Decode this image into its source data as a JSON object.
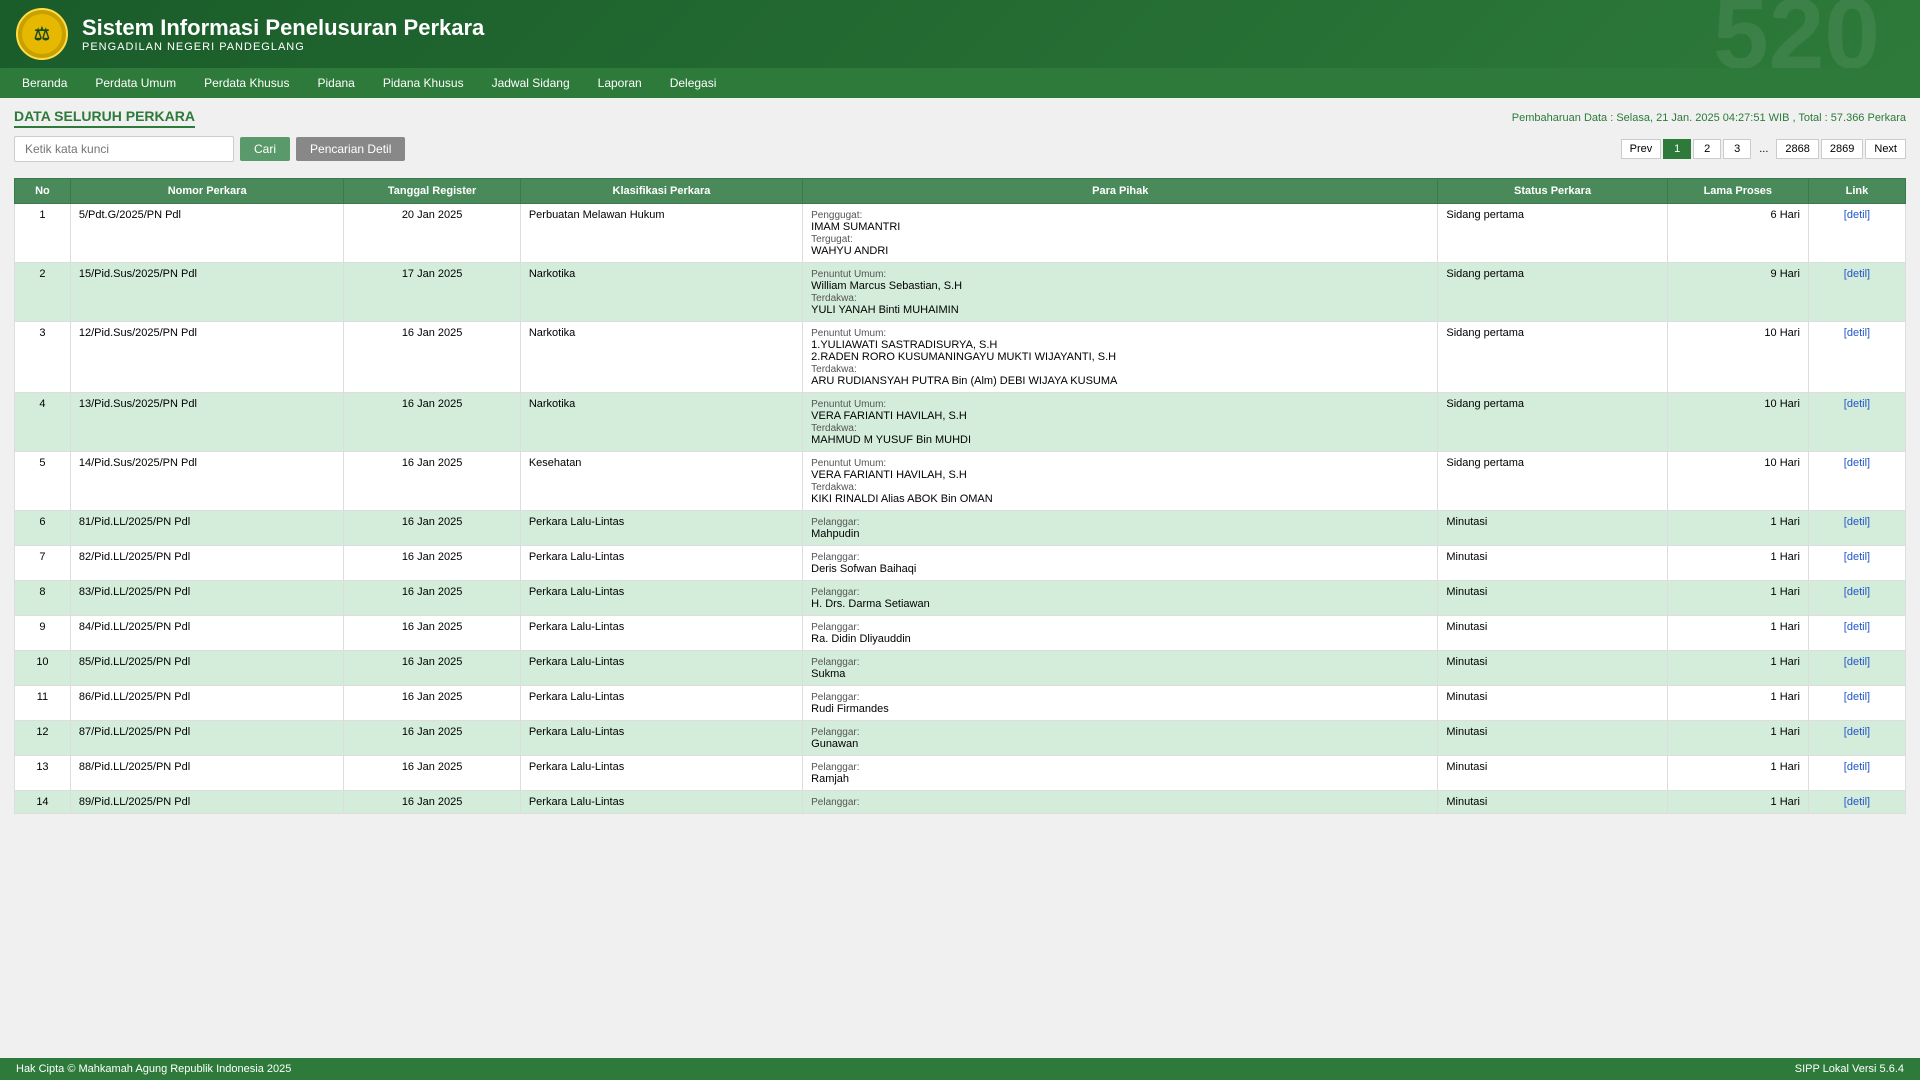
{
  "header": {
    "title": "Sistem Informasi Penelusuran Perkara",
    "subtitle": "PENGADILAN NEGERI PANDEGLANG",
    "watermark": "520"
  },
  "navbar": {
    "items": [
      "Beranda",
      "Perdata Umum",
      "Perdata Khusus",
      "Pidana",
      "Pidana Khusus",
      "Jadwal Sidang",
      "Laporan",
      "Delegasi"
    ]
  },
  "page": {
    "title": "DATA SELURUH PERKARA",
    "update_info": "Pembaharuan Data : Selasa, 21 Jan. 2025 04:27:51 WIB , Total : 57.366 Perkara"
  },
  "search": {
    "placeholder": "Ketik kata kunci",
    "search_label": "Cari",
    "detail_label": "Pencarian Detil"
  },
  "pagination": {
    "prev": "Prev",
    "next": "Next",
    "pages": [
      "1",
      "2",
      "3"
    ],
    "dots": "...",
    "last_pages": [
      "2868",
      "2869"
    ]
  },
  "table": {
    "headers": [
      "No",
      "Nomor Perkara",
      "Tanggal Register",
      "Klasifikasi Perkara",
      "Para Pihak",
      "Status Perkara",
      "Lama Proses",
      "Link"
    ],
    "rows": [
      {
        "no": "1",
        "nomor": "5/Pdt.G/2025/PN Pdl",
        "tanggal": "20 Jan 2025",
        "klasifikasi": "Perbuatan Melawan Hukum",
        "pihak": [
          {
            "label": "Penggugat:",
            "name": "IMAM SUMANTRI"
          },
          {
            "label": "Tergugat:",
            "name": "WAHYU ANDRI"
          }
        ],
        "status": "Sidang pertama",
        "lama": "6 Hari",
        "link": "[detil]"
      },
      {
        "no": "2",
        "nomor": "15/Pid.Sus/2025/PN Pdl",
        "tanggal": "17 Jan 2025",
        "klasifikasi": "Narkotika",
        "pihak": [
          {
            "label": "Penuntut Umum:",
            "name": "William Marcus Sebastian, S.H"
          },
          {
            "label": "Terdakwa:",
            "name": "YULI YANAH Binti MUHAIMIN"
          }
        ],
        "status": "Sidang pertama",
        "lama": "9 Hari",
        "link": "[detil]"
      },
      {
        "no": "3",
        "nomor": "12/Pid.Sus/2025/PN Pdl",
        "tanggal": "16 Jan 2025",
        "klasifikasi": "Narkotika",
        "pihak": [
          {
            "label": "Penuntut Umum:",
            "name": "1.YULIAWATI SASTRADISURYA, S.H\n2.RADEN RORO KUSUMANINGAYU MUKTI WIJAYANTI, S.H"
          },
          {
            "label": "Terdakwa:",
            "name": "ARU RUDIANSYAH PUTRA Bin (Alm) DEBI WIJAYA KUSUMA"
          }
        ],
        "status": "Sidang pertama",
        "lama": "10 Hari",
        "link": "[detil]"
      },
      {
        "no": "4",
        "nomor": "13/Pid.Sus/2025/PN Pdl",
        "tanggal": "16 Jan 2025",
        "klasifikasi": "Narkotika",
        "pihak": [
          {
            "label": "Penuntut Umum:",
            "name": "VERA FARIANTI HAVILAH, S.H"
          },
          {
            "label": "Terdakwa:",
            "name": "MAHMUD M YUSUF Bin MUHDI"
          }
        ],
        "status": "Sidang pertama",
        "lama": "10 Hari",
        "link": "[detil]"
      },
      {
        "no": "5",
        "nomor": "14/Pid.Sus/2025/PN Pdl",
        "tanggal": "16 Jan 2025",
        "klasifikasi": "Kesehatan",
        "pihak": [
          {
            "label": "Penuntut Umum:",
            "name": "VERA FARIANTI HAVILAH, S.H"
          },
          {
            "label": "Terdakwa:",
            "name": "KIKI RINALDI Alias ABOK Bin OMAN"
          }
        ],
        "status": "Sidang pertama",
        "lama": "10 Hari",
        "link": "[detil]"
      },
      {
        "no": "6",
        "nomor": "81/Pid.LL/2025/PN Pdl",
        "tanggal": "16 Jan 2025",
        "klasifikasi": "Perkara Lalu-Lintas",
        "pihak": [
          {
            "label": "Pelanggar:",
            "name": "Mahpudin"
          }
        ],
        "status": "Minutasi",
        "lama": "1 Hari",
        "link": "[detil]"
      },
      {
        "no": "7",
        "nomor": "82/Pid.LL/2025/PN Pdl",
        "tanggal": "16 Jan 2025",
        "klasifikasi": "Perkara Lalu-Lintas",
        "pihak": [
          {
            "label": "Pelanggar:",
            "name": "Deris Sofwan Baihaqi"
          }
        ],
        "status": "Minutasi",
        "lama": "1 Hari",
        "link": "[detil]"
      },
      {
        "no": "8",
        "nomor": "83/Pid.LL/2025/PN Pdl",
        "tanggal": "16 Jan 2025",
        "klasifikasi": "Perkara Lalu-Lintas",
        "pihak": [
          {
            "label": "Pelanggar:",
            "name": "H. Drs. Darma Setiawan"
          }
        ],
        "status": "Minutasi",
        "lama": "1 Hari",
        "link": "[detil]"
      },
      {
        "no": "9",
        "nomor": "84/Pid.LL/2025/PN Pdl",
        "tanggal": "16 Jan 2025",
        "klasifikasi": "Perkara Lalu-Lintas",
        "pihak": [
          {
            "label": "Pelanggar:",
            "name": "Ra. Didin Dliyauddin"
          }
        ],
        "status": "Minutasi",
        "lama": "1 Hari",
        "link": "[detil]"
      },
      {
        "no": "10",
        "nomor": "85/Pid.LL/2025/PN Pdl",
        "tanggal": "16 Jan 2025",
        "klasifikasi": "Perkara Lalu-Lintas",
        "pihak": [
          {
            "label": "Pelanggar:",
            "name": "Sukma"
          }
        ],
        "status": "Minutasi",
        "lama": "1 Hari",
        "link": "[detil]"
      },
      {
        "no": "11",
        "nomor": "86/Pid.LL/2025/PN Pdl",
        "tanggal": "16 Jan 2025",
        "klasifikasi": "Perkara Lalu-Lintas",
        "pihak": [
          {
            "label": "Pelanggar:",
            "name": "Rudi Firmandes"
          }
        ],
        "status": "Minutasi",
        "lama": "1 Hari",
        "link": "[detil]"
      },
      {
        "no": "12",
        "nomor": "87/Pid.LL/2025/PN Pdl",
        "tanggal": "16 Jan 2025",
        "klasifikasi": "Perkara Lalu-Lintas",
        "pihak": [
          {
            "label": "Pelanggar:",
            "name": "Gunawan"
          }
        ],
        "status": "Minutasi",
        "lama": "1 Hari",
        "link": "[detil]"
      },
      {
        "no": "13",
        "nomor": "88/Pid.LL/2025/PN Pdl",
        "tanggal": "16 Jan 2025",
        "klasifikasi": "Perkara Lalu-Lintas",
        "pihak": [
          {
            "label": "Pelanggar:",
            "name": "Ramjah"
          }
        ],
        "status": "Minutasi",
        "lama": "1 Hari",
        "link": "[detil]"
      },
      {
        "no": "14",
        "nomor": "89/Pid.LL/2025/PN Pdl",
        "tanggal": "16 Jan 2025",
        "klasifikasi": "Perkara Lalu-Lintas",
        "pihak": [
          {
            "label": "Pelanggar:",
            "name": ""
          }
        ],
        "status": "Minutasi",
        "lama": "1 Hari",
        "link": "[detil]"
      }
    ]
  },
  "footer": {
    "copyright": "Hak Cipta © Mahkamah Agung Republik Indonesia 2025",
    "version": "SIPP Lokal Versi 5.6.4"
  }
}
